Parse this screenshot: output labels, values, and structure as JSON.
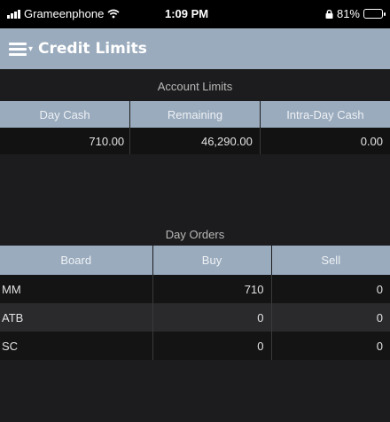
{
  "status_bar": {
    "carrier": "Grameenphone",
    "time": "1:09 PM",
    "battery": "81%",
    "battery_level": 0.81
  },
  "header": {
    "title": "Credit Limits"
  },
  "account_limits": {
    "section_title": "Account Limits",
    "columns": [
      "Day Cash",
      "Remaining",
      "Intra-Day Cash"
    ],
    "row": [
      "710.00",
      "46,290.00",
      "0.00"
    ]
  },
  "day_orders": {
    "section_title": "Day Orders",
    "columns": [
      "Board",
      "Buy",
      "Sell"
    ],
    "rows": [
      [
        "MM",
        "710",
        "0"
      ],
      [
        "ATB",
        "0",
        "0"
      ],
      [
        "SC",
        "0",
        "0"
      ]
    ]
  },
  "colors": {
    "header": "#9aabbd",
    "background": "#1c1c1e"
  }
}
